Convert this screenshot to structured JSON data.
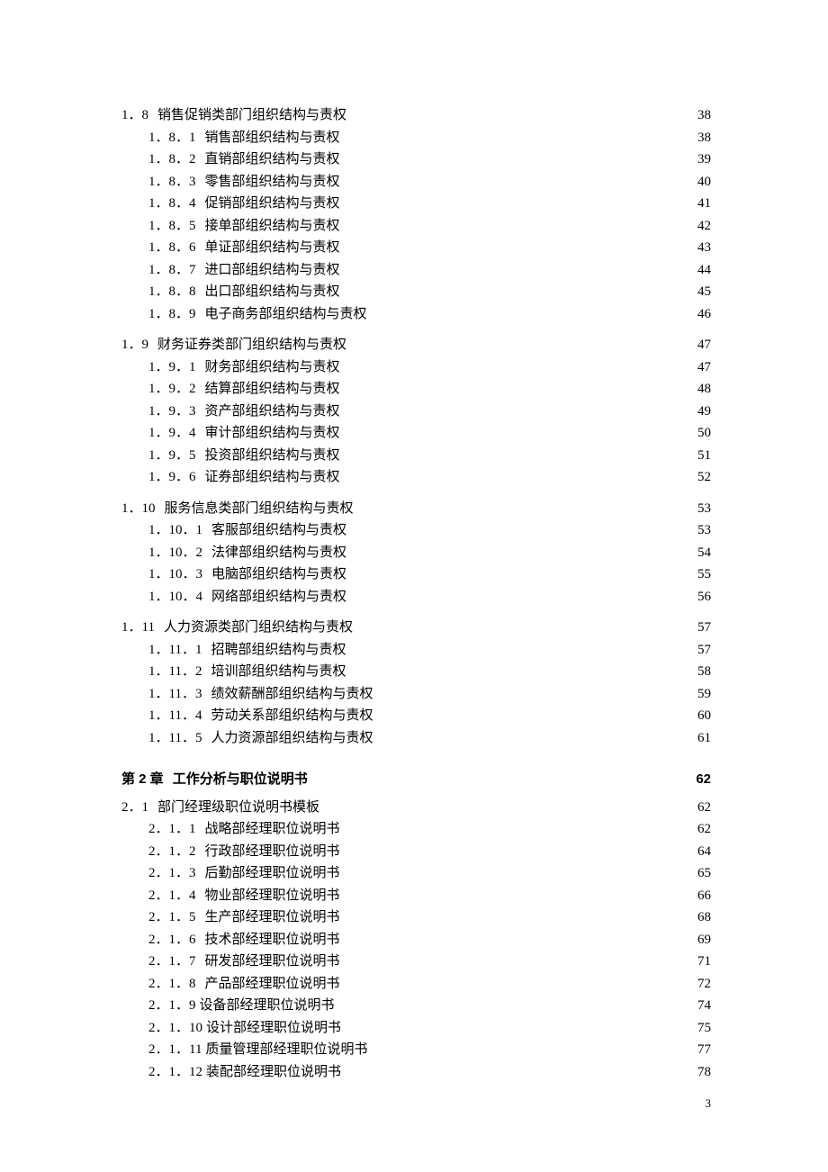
{
  "page_number": "3",
  "toc": [
    {
      "type": "lvl1",
      "num": "1．8",
      "title": "销售促销类部门组织结构与责权",
      "page": "38"
    },
    {
      "type": "lvl2",
      "num": "1．8．1",
      "title": "销售部组织结构与责权",
      "page": "38"
    },
    {
      "type": "lvl2",
      "num": "1．8．2",
      "title": "直销部组织结构与责权",
      "page": "39"
    },
    {
      "type": "lvl2",
      "num": "1．8．3",
      "title": "零售部组织结构与责权",
      "page": "40"
    },
    {
      "type": "lvl2",
      "num": "1．8．4",
      "title": "促销部组织结构与责权",
      "page": "41"
    },
    {
      "type": "lvl2",
      "num": "1．8．5",
      "title": "接单部组织结构与责权",
      "page": "42"
    },
    {
      "type": "lvl2",
      "num": "1．8．6",
      "title": "单证部组织结构与责权",
      "page": "43"
    },
    {
      "type": "lvl2",
      "num": "1．8．7",
      "title": "进口部组织结构与责权",
      "page": "44"
    },
    {
      "type": "lvl2",
      "num": "1．8．8",
      "title": "出口部组织结构与责权",
      "page": "45"
    },
    {
      "type": "lvl2",
      "num": "1．8．9",
      "title": "电子商务部组织结构与责权",
      "page": "46"
    },
    {
      "type": "gap"
    },
    {
      "type": "lvl1",
      "num": "1．9",
      "title": "财务证券类部门组织结构与责权",
      "page": "47"
    },
    {
      "type": "lvl2",
      "num": "1．9．1",
      "title": "财务部组织结构与责权",
      "page": "47"
    },
    {
      "type": "lvl2",
      "num": "1．9．2",
      "title": "结算部组织结构与责权",
      "page": "48"
    },
    {
      "type": "lvl2",
      "num": "1．9．3",
      "title": "资产部组织结构与责权",
      "page": "49"
    },
    {
      "type": "lvl2",
      "num": "1．9．4",
      "title": "审计部组织结构与责权",
      "page": "50"
    },
    {
      "type": "lvl2",
      "num": "1．9．5",
      "title": "投资部组织结构与责权",
      "page": "51"
    },
    {
      "type": "lvl2",
      "num": "1．9．6",
      "title": "证券部组织结构与责权",
      "page": "52"
    },
    {
      "type": "gap"
    },
    {
      "type": "lvl1",
      "num": "1．10",
      "title": "服务信息类部门组织结构与责权",
      "page": "53"
    },
    {
      "type": "lvl2",
      "num": "1．10．1",
      "title": "客服部组织结构与责权",
      "page": "53"
    },
    {
      "type": "lvl2",
      "num": "1．10．2",
      "title": "法律部组织结构与责权",
      "page": "54"
    },
    {
      "type": "lvl2",
      "num": "1．10．3",
      "title": "电脑部组织结构与责权",
      "page": "55"
    },
    {
      "type": "lvl2",
      "num": "1．10．4",
      "title": "网络部组织结构与责权",
      "page": "56"
    },
    {
      "type": "gap"
    },
    {
      "type": "lvl1",
      "num": "1．11",
      "title": "人力资源类部门组织结构与责权",
      "page": "57"
    },
    {
      "type": "lvl2",
      "num": "1．11．1",
      "title": "招聘部组织结构与责权",
      "page": "57"
    },
    {
      "type": "lvl2",
      "num": "1．11．2",
      "title": "培训部组织结构与责权",
      "page": "58"
    },
    {
      "type": "lvl2",
      "num": "1．11．3",
      "title": "绩效薪酬部组织结构与责权",
      "page": "59"
    },
    {
      "type": "lvl2",
      "num": "1．11．4",
      "title": "劳动关系部组织结构与责权",
      "page": "60"
    },
    {
      "type": "lvl2",
      "num": "1．11．5",
      "title": "人力资源部组织结构与责权",
      "page": "61"
    },
    {
      "type": "chap",
      "num": "第 2 章",
      "title": "工作分析与职位说明书",
      "page": "62"
    },
    {
      "type": "lvl1",
      "num": "2．1",
      "title": "部门经理级职位说明书模板",
      "page": "62"
    },
    {
      "type": "lvl2",
      "num": "2．1．1",
      "title": "战略部经理职位说明书",
      "page": "62"
    },
    {
      "type": "lvl2",
      "num": "2．1．2",
      "title": "行政部经理职位说明书",
      "page": "64"
    },
    {
      "type": "lvl2",
      "num": "2．1．3",
      "title": "后勤部经理职位说明书",
      "page": "65"
    },
    {
      "type": "lvl2",
      "num": "2．1．4",
      "title": "物业部经理职位说明书",
      "page": "66"
    },
    {
      "type": "lvl2",
      "num": "2．1．5",
      "title": "生产部经理职位说明书",
      "page": "68"
    },
    {
      "type": "lvl2",
      "num": "2．1．6",
      "title": "技术部经理职位说明书",
      "page": "69"
    },
    {
      "type": "lvl2",
      "num": "2．1．7",
      "title": "研发部经理职位说明书",
      "page": "71"
    },
    {
      "type": "lvl2",
      "num": "2．1．8",
      "title": "产品部经理职位说明书",
      "page": "72"
    },
    {
      "type": "lvl2",
      "num": "2．1．9",
      "title": "设备部经理职位说明书",
      "page": "74",
      "nospace": true
    },
    {
      "type": "lvl2",
      "num": "2．1．10",
      "title": "设计部经理职位说明书",
      "page": "75",
      "nospace": true
    },
    {
      "type": "lvl2",
      "num": "2．1．11",
      "title": "质量管理部经理职位说明书",
      "page": "77",
      "nospace": true
    },
    {
      "type": "lvl2",
      "num": "2．1．12",
      "title": "装配部经理职位说明书",
      "page": "78",
      "nospace": true
    }
  ]
}
